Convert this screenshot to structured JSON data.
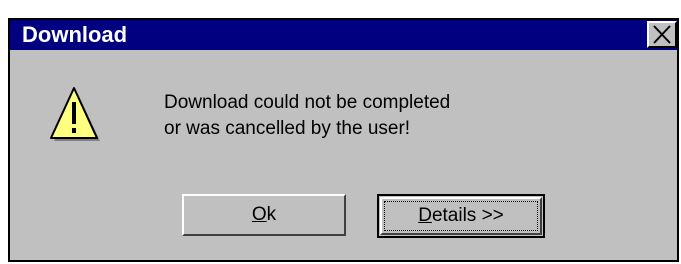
{
  "dialog": {
    "title": "Download",
    "close_label": "Close",
    "message_line1": "Download could not be completed",
    "message_line2": "or was cancelled by the user!",
    "icon": "warning-icon",
    "buttons": {
      "ok_mnemonic": "O",
      "ok_rest": "k",
      "details_mnemonic": "D",
      "details_rest": "etails >>"
    },
    "colors": {
      "titlebar": "#000080",
      "face": "#c0c0c0",
      "warning": "#ffff80"
    }
  }
}
